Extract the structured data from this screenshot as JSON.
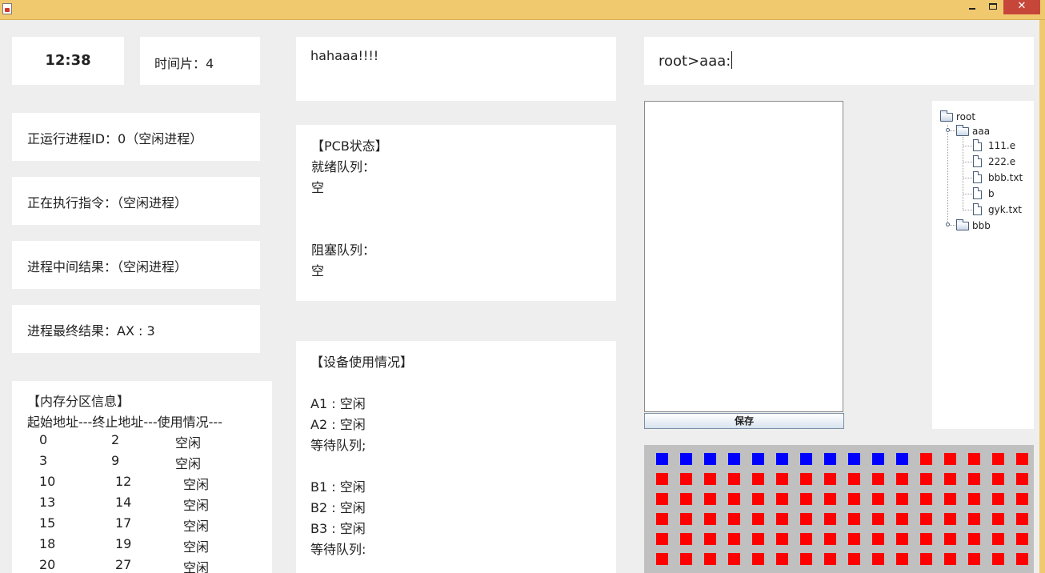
{
  "window": {
    "minimize_label": "—",
    "close_label": "✕"
  },
  "clock": {
    "time": "12:38"
  },
  "time_slice": {
    "label": "时间片：4"
  },
  "status": {
    "running_pid": "正运行进程ID：0（空闲进程）",
    "executing_instruction": "正在执行指令：（空闲进程）",
    "intermediate_result": "进程中间结果：（空闲进程）",
    "final_result": "进程最终结果：AX : 3"
  },
  "memory": {
    "title": "【内存分区信息】",
    "header": "起始地址---终止地址---使用情况---",
    "rows": [
      {
        "start": "0",
        "end": "2",
        "usage": "空闲"
      },
      {
        "start": "3",
        "end": "9",
        "usage": "空闲"
      },
      {
        "start": "10",
        "end": "12",
        "usage": "空闲"
      },
      {
        "start": "13",
        "end": "14",
        "usage": "空闲"
      },
      {
        "start": "15",
        "end": "17",
        "usage": "空闲"
      },
      {
        "start": "18",
        "end": "19",
        "usage": "空闲"
      },
      {
        "start": "20",
        "end": "27",
        "usage": "空闲"
      }
    ]
  },
  "message": {
    "text": "hahaaa!!!!"
  },
  "pcb": {
    "title": "【PCB状态】",
    "ready_label": "就绪队列：",
    "ready_value": "空",
    "blocked_label": "阻塞队列：",
    "blocked_value": "空"
  },
  "devices": {
    "title": "【设备使用情况】",
    "a1": "A1 : 空闲",
    "a2": "A2 : 空闲",
    "a_wait": "等待队列;",
    "b1": "B1 : 空闲",
    "b2": "B2 : 空闲",
    "b3": "B3 : 空闲",
    "b_wait": "等待队列:"
  },
  "command": {
    "prompt": "root>aaa:"
  },
  "editor": {
    "save_label": "保存"
  },
  "file_tree": {
    "root": "root",
    "folder_aaa": "aaa",
    "files": [
      "111.e",
      "222.e",
      "bbb.txt",
      "b",
      "gyk.txt"
    ],
    "folder_bbb": "bbb"
  },
  "disk": {
    "used_blocks": 11,
    "blocks_per_row": 16,
    "rows": 6,
    "used_color": "#0000ff",
    "free_color": "#ff0000"
  }
}
